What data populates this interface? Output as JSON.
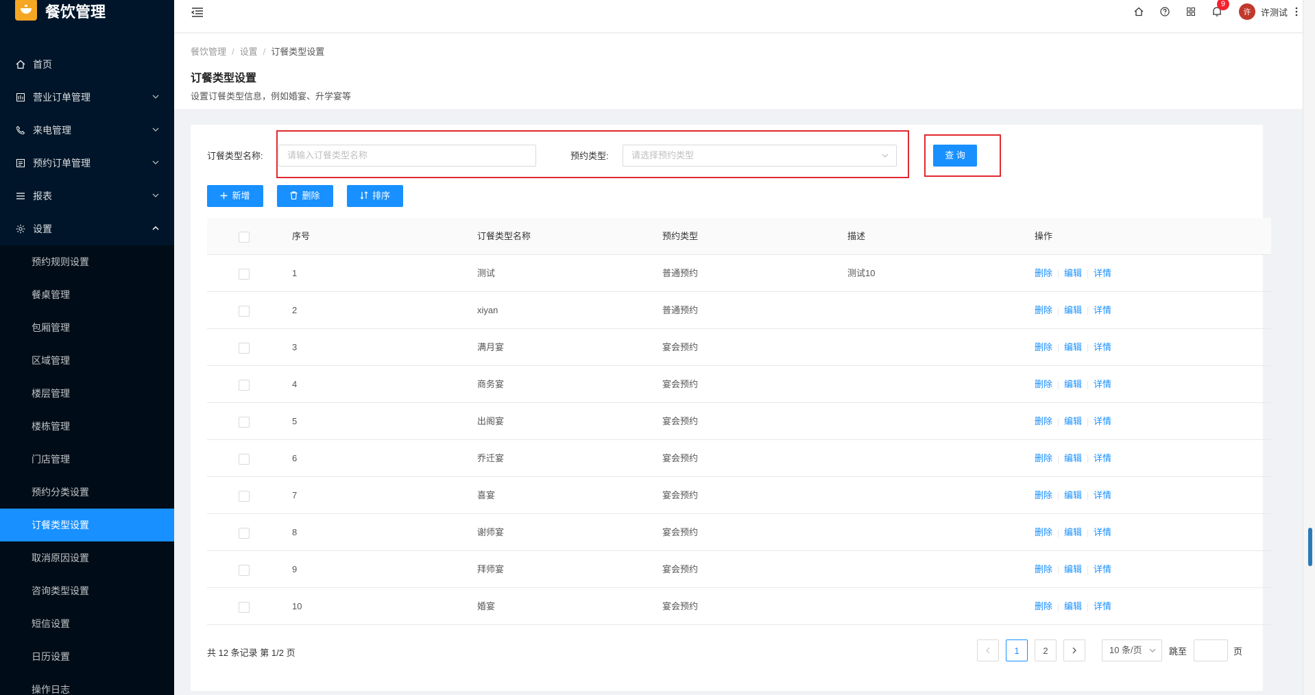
{
  "app": {
    "title": "餐饮管理"
  },
  "sidebar": {
    "items": [
      {
        "label": "首页",
        "icon": "home-icon",
        "chevron": false
      },
      {
        "label": "营业订单管理",
        "icon": "order-icon",
        "chevron": "down"
      },
      {
        "label": "来电管理",
        "icon": "phone-icon",
        "chevron": "down"
      },
      {
        "label": "预约订单管理",
        "icon": "list-icon",
        "chevron": "down"
      },
      {
        "label": "报表",
        "icon": "menu-icon",
        "chevron": "down"
      },
      {
        "label": "设置",
        "icon": "gear-icon",
        "chevron": "up"
      }
    ],
    "sub_items": [
      "预约规则设置",
      "餐桌管理",
      "包厢管理",
      "区域管理",
      "楼层管理",
      "楼栋管理",
      "门店管理",
      "预约分类设置",
      "订餐类型设置",
      "取消原因设置",
      "咨询类型设置",
      "短信设置",
      "日历设置",
      "操作日志"
    ],
    "active_sub": "订餐类型设置"
  },
  "header": {
    "notification_count": "9",
    "user_name": "许测试",
    "avatar_text": "许"
  },
  "breadcrumb": {
    "items": [
      "餐饮管理",
      "设置",
      "订餐类型设置"
    ]
  },
  "page": {
    "title": "订餐类型设置",
    "description": "设置订餐类型信息，例如婚宴、升学宴等"
  },
  "search": {
    "name_label": "订餐类型名称:",
    "name_placeholder": "请输入订餐类型名称",
    "type_label": "预约类型:",
    "type_placeholder": "请选择预约类型",
    "query_button": "查 询"
  },
  "toolbar": {
    "add": "新增",
    "delete": "删除",
    "sort": "排序"
  },
  "table": {
    "headers": {
      "index": "序号",
      "name": "订餐类型名称",
      "type": "预约类型",
      "desc": "描述",
      "ops": "操作"
    },
    "rows": [
      {
        "index": "1",
        "name": "测试",
        "type": "普通预约",
        "desc": "测试10"
      },
      {
        "index": "2",
        "name": "xiyan",
        "type": "普通预约",
        "desc": ""
      },
      {
        "index": "3",
        "name": "满月宴",
        "type": "宴会预约",
        "desc": ""
      },
      {
        "index": "4",
        "name": "商务宴",
        "type": "宴会预约",
        "desc": ""
      },
      {
        "index": "5",
        "name": "出阁宴",
        "type": "宴会预约",
        "desc": ""
      },
      {
        "index": "6",
        "name": "乔迁宴",
        "type": "宴会预约",
        "desc": ""
      },
      {
        "index": "7",
        "name": "喜宴",
        "type": "宴会预约",
        "desc": ""
      },
      {
        "index": "8",
        "name": "谢师宴",
        "type": "宴会预约",
        "desc": ""
      },
      {
        "index": "9",
        "name": "拜师宴",
        "type": "宴会预约",
        "desc": ""
      },
      {
        "index": "10",
        "name": "婚宴",
        "type": "宴会预约",
        "desc": ""
      }
    ],
    "op_labels": {
      "delete": "删除",
      "edit": "编辑",
      "detail": "详情"
    }
  },
  "pagination": {
    "total_text": "共 12 条记录 第 1/2 页",
    "pages": [
      "1",
      "2"
    ],
    "current": "1",
    "page_size": "10 条/页",
    "jump_label": "跳至",
    "page_label": "页"
  },
  "colors": {
    "primary": "#1890ff",
    "sidebar_bg": "#001529",
    "highlight": "#e0282e",
    "logo": "#f5a623"
  }
}
